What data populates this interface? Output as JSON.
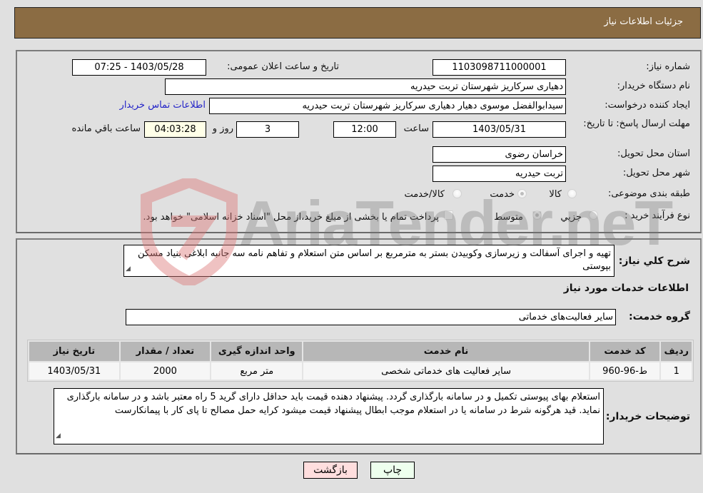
{
  "header": {
    "title": "جزئیات اطلاعات نیاز"
  },
  "details": {
    "need_number_label": "شماره نیاز:",
    "need_number": "1103098711000001",
    "announce_label": "تاریخ و ساعت اعلان عمومی:",
    "announce_value": "1403/05/28 - 07:25",
    "buyer_org_label": "نام دستگاه خریدار:",
    "buyer_org": "دهیاری سرکاریز  شهرستان تربت حیدریه",
    "creator_label": "ایجاد کننده درخواست:",
    "creator": "سیدابوالفضل موسوی دهیار دهیاری سرکاریز  شهرستان تربت حیدریه",
    "contact_link": "اطلاعات تماس خریدار",
    "deadline_label": "مهلت ارسال پاسخ: تا تاریخ:",
    "deadline_date": "1403/05/31",
    "time_label": "ساعت",
    "deadline_time": "12:00",
    "days_value": "3",
    "days_label": "روز و",
    "remaining_time": "04:03:28",
    "remaining_label": "ساعت باقي مانده",
    "province_label": "استان محل تحویل:",
    "province": "خراسان رضوی",
    "city_label": "شهر محل تحویل:",
    "city": "تربت حیدریه",
    "category_label": "طبقه بندی موضوعی:",
    "category_options": [
      {
        "label": "کالا",
        "selected": false
      },
      {
        "label": "خدمت",
        "selected": true
      },
      {
        "label": "کالا/خدمت",
        "selected": false
      }
    ],
    "process_label": "نوع فرآیند خرید :",
    "process_options": [
      {
        "label": "جزيي",
        "selected": false
      },
      {
        "label": "متوسط",
        "selected": true
      }
    ],
    "treasury_checkbox_label": "پرداخت تمام یا بخشی از مبلغ خرید،از محل \"اسناد خزانه اسلامی\" خواهد بود.",
    "treasury_checked": false
  },
  "services": {
    "description_label": "شرح كلي نياز:",
    "description": "تهیه و اجرای آسفالت و زیرسازی وکوبیدن بستر به مترمربع بر اساس متن استعلام و تفاهم نامه سه جانبه ابلاغی بنیاد مسکن بپوستی",
    "section_title": "اطلاعات خدمات مورد نياز",
    "group_label": "گروه خدمت:",
    "group_value": "سایر فعالیت‌های خدماتی",
    "table": {
      "headers": [
        "ردیف",
        "کد خدمت",
        "نام خدمت",
        "واحد اندازه گیری",
        "تعداد / مقدار",
        "تاریخ نیاز"
      ],
      "rows": [
        [
          "1",
          "ط-96-960",
          "سایر فعالیت های خدماتی شخصی",
          "متر مربع",
          "2000",
          "1403/05/31"
        ]
      ]
    },
    "buyer_notes_label": "توضیحات خریدار:",
    "buyer_notes": "استعلام بهای پیوستی تکمیل و در سامانه بارگذاری گردد. پیشنهاد دهنده قیمت باید حداقل دارای گرید 5 راه  معتبر باشد و در سامانه بارگذاری نماید. قید هرگونه شرط در سامانه یا در استعلام موجب ابطال پیشنهاد قیمت میشود کرایه حمل مصالح تا پای کار با پیمانکارست"
  },
  "buttons": {
    "print": "چاپ",
    "back": "بازگشت"
  },
  "watermark": "AriaTender.neT",
  "colors": {
    "header_bg": "#8b6c43",
    "link": "#2323c8",
    "back_button_bg": "#ffdede",
    "print_button_bg": "#eeffee",
    "remaining_bg": "#ffffe8"
  }
}
